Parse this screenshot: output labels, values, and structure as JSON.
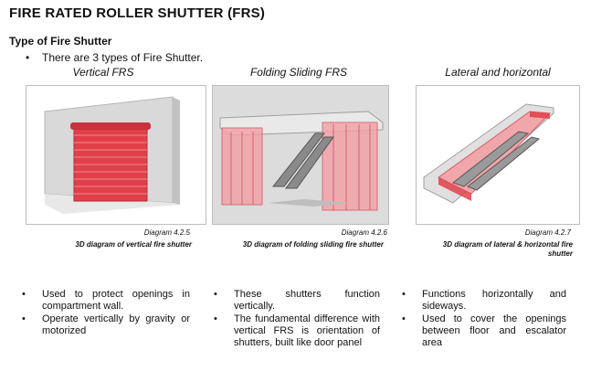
{
  "header": {
    "title": "FIRE RATED ROLLER SHUTTER (FRS)",
    "subtitle": "Type of Fire Shutter",
    "intro": "There are 3 types of Fire Shutter.",
    "bullet": "•"
  },
  "columns": [
    {
      "heading": "Vertical FRS",
      "diagram_number": "Diagram 4.2.5",
      "diagram_title": "3D diagram of vertical fire shutter",
      "points": [
        "Used to protect openings in compartment wall.",
        "Operate vertically by gravity or motorized"
      ]
    },
    {
      "heading": "Folding Sliding FRS",
      "diagram_number": "Diagram 4.2.6",
      "diagram_title": "3D diagram of folding sliding fire shutter",
      "points": [
        "These shutters function vertically.",
        "The fundamental difference with vertical FRS is orientation of shutters, built like door panel"
      ]
    },
    {
      "heading": "Lateral and horizontal",
      "diagram_number": "Diagram 4.2.7",
      "diagram_title_line1": "3D diagram of lateral & horizontal fire",
      "diagram_title_line2": "shutter",
      "points": [
        "Functions horizontally and sideways.",
        "Used to cover the openings between floor and escalator area"
      ]
    }
  ],
  "colors": {
    "shutter_red": "#e0404a",
    "shutter_pink": "#f2a0a6",
    "wall_grey": "#d9d9d9"
  }
}
